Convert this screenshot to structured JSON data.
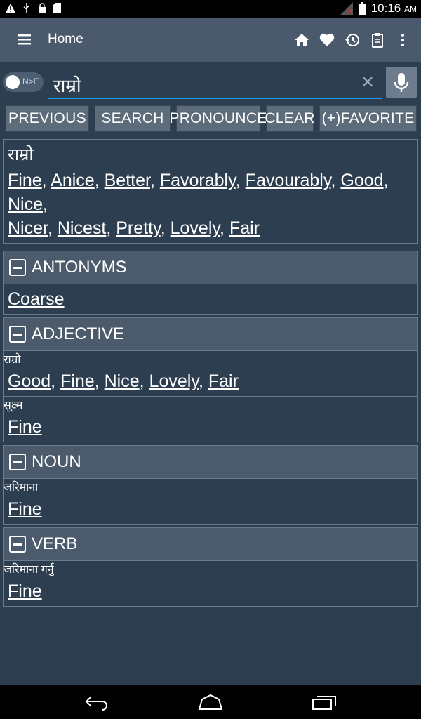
{
  "status": {
    "time": "10:16",
    "ampm": "AM"
  },
  "header": {
    "title": "Home"
  },
  "search": {
    "value": "राम्रो",
    "toggle_label": "N>E"
  },
  "buttons": {
    "previous": "PREVIOUS",
    "search": "SEARCH",
    "pronounce": "PRONOUNCE",
    "clear": "CLEAR",
    "favorite": "(+)FAVORITE"
  },
  "main": {
    "headword": "राम्रो",
    "translations": [
      "Fine",
      "Anice",
      "Better",
      "Favorably",
      "Favourably",
      "Good",
      "Nice",
      "Nicer",
      "Nicest",
      "Pretty",
      "Lovely",
      "Fair"
    ]
  },
  "antonyms": {
    "title": "ANTONYMS",
    "words": [
      "Coarse"
    ]
  },
  "adjective": {
    "title": "ADJECTIVE",
    "entries": [
      {
        "word": "राम्रो",
        "links": [
          "Good",
          "Fine",
          "Nice",
          "Lovely",
          "Fair"
        ]
      },
      {
        "word": "सूक्ष्म",
        "links": [
          "Fine"
        ]
      }
    ]
  },
  "noun": {
    "title": "NOUN",
    "entries": [
      {
        "word": "जरिमाना",
        "links": [
          "Fine"
        ]
      }
    ]
  },
  "verb": {
    "title": "VERB",
    "entries": [
      {
        "word": "जरिमाना गर्नु",
        "links": [
          "Fine"
        ]
      }
    ]
  },
  "icons": {
    "menu": "menu-icon",
    "home": "home-icon",
    "favorite": "heart-icon",
    "history": "history-icon",
    "clipboard": "clipboard-icon",
    "more": "more-vert-icon",
    "mic": "microphone-icon"
  }
}
